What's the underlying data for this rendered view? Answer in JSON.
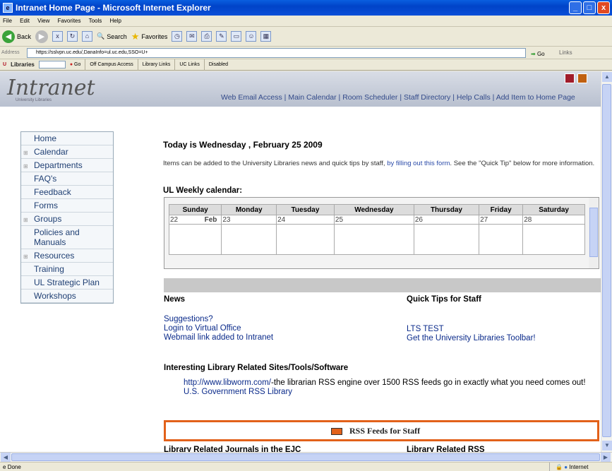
{
  "window": {
    "title": "Intranet Home Page - Microsoft Internet Explorer",
    "app_icon": "ie-icon",
    "min": "_",
    "max": "□",
    "close": "x"
  },
  "menu": [
    "File",
    "Edit",
    "View",
    "Favorites",
    "Tools",
    "Help"
  ],
  "toolbar": {
    "back": "Back",
    "search": "Search",
    "favorites": "Favorites"
  },
  "address": {
    "label": "Address",
    "url": "https://sslvpn.uc.edu/,DanaInfo=ul.uc.edu,SSO=U+",
    "go": "Go",
    "links": "Links"
  },
  "linkbar": {
    "brand": "Libraries",
    "search_placeholder": "",
    "go": "Go",
    "items": [
      "Off Campus Access",
      "Library Links",
      "UC Links",
      "Disabled"
    ]
  },
  "header": {
    "logo": "Intranet",
    "logo_sub": "University Libraries",
    "links": [
      "Web Email Access",
      "Main Calendar",
      "Room Scheduler",
      "Staff Directory",
      "Help Calls",
      "Add Item to Home Page"
    ],
    "separator": " | "
  },
  "sidenav": [
    {
      "label": "Home",
      "expand": false
    },
    {
      "label": "Calendar",
      "expand": true
    },
    {
      "label": "Departments",
      "expand": true
    },
    {
      "label": "FAQ's",
      "expand": false
    },
    {
      "label": "Feedback",
      "expand": false
    },
    {
      "label": "Forms",
      "expand": false
    },
    {
      "label": "Groups",
      "expand": true
    },
    {
      "label": "Policies and Manuals",
      "expand": false
    },
    {
      "label": "Resources",
      "expand": true
    },
    {
      "label": "Training",
      "expand": false
    },
    {
      "label": "UL Strategic Plan",
      "expand": false
    },
    {
      "label": "Workshops",
      "expand": false
    }
  ],
  "main": {
    "today": "Today is Wednesday , February 25 2009",
    "intro_a": "Items can be added to the University Libraries news and quick tips by staff, ",
    "intro_link": "by filling out this form",
    "intro_b": ". See the \"Quick Tip\" below for more information.",
    "calendar_title": "UL Weekly calendar:",
    "calendar": {
      "days": [
        "Sunday",
        "Monday",
        "Tuesday",
        "Wednesday",
        "Thursday",
        "Friday",
        "Saturday"
      ],
      "dates": [
        "22",
        "23",
        "24",
        "25",
        "26",
        "27",
        "28"
      ],
      "month": "Feb"
    },
    "news_title": "News",
    "news": [
      "Suggestions?",
      "Login to Virtual Office",
      "Webmail link added to Intranet"
    ],
    "tips_title": "Quick Tips for Staff",
    "tips": [
      "LTS TEST",
      "Get the University Libraries Toolbar!"
    ],
    "sites_title": "Interesting Library Related Sites/Tools/Software",
    "sites": [
      {
        "link": "http://www.libworm.com/",
        "desc": "-the librarian RSS engine over 1500 RSS feeds go in exactly what you need comes out!"
      },
      {
        "link": "U.S. Government RSS Library",
        "desc": ""
      }
    ],
    "rss": "RSS Feeds for Staff",
    "cut_left": "Library Related Journals in the EJC",
    "cut_right": "Library Related RSS"
  },
  "status": {
    "left": "Done",
    "zone": "Internet"
  }
}
